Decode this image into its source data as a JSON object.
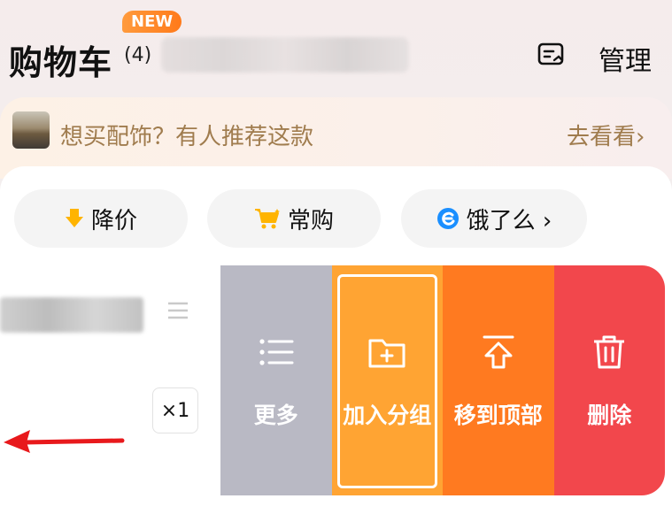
{
  "header": {
    "title": "购物车",
    "count": "(4)",
    "new_badge": "NEW",
    "manage_label": "管理"
  },
  "promo": {
    "text": "想买配饰？有人推荐这款",
    "link": "去看看›"
  },
  "filters": [
    {
      "label": "降价",
      "icon": "price-drop-arrow-icon"
    },
    {
      "label": "常购",
      "icon": "shopping-cart-icon"
    },
    {
      "label": "饿了么 ›",
      "icon": "eleme-logo-icon"
    }
  ],
  "item": {
    "quantity": "×1"
  },
  "actions": [
    {
      "label": "更多",
      "icon": "list-icon",
      "color": "#b9b9c4"
    },
    {
      "label": "加入分组",
      "icon": "folder-add-icon",
      "color": "#ffa433"
    },
    {
      "label": "移到顶部",
      "icon": "move-to-top-icon",
      "color": "#ff7a20"
    },
    {
      "label": "删除",
      "icon": "trash-icon",
      "color": "#f2474c"
    }
  ],
  "colors": {
    "accent_orange": "#ff7a20",
    "delete_red": "#f2474c",
    "promo_text": "#a07c4e"
  }
}
